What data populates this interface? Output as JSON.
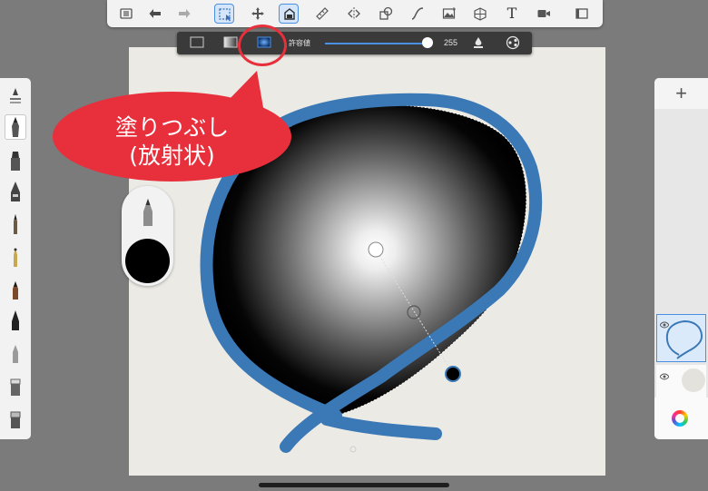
{
  "toolbar": {
    "tools": [
      {
        "name": "list-icon"
      },
      {
        "name": "undo-icon"
      },
      {
        "name": "redo-icon"
      },
      {
        "name": "selection-tool-icon",
        "active": true
      },
      {
        "name": "transform-icon"
      },
      {
        "name": "fill-tool-icon",
        "active": true
      },
      {
        "name": "ruler-icon"
      },
      {
        "name": "symmetry-icon"
      },
      {
        "name": "shapes-icon"
      },
      {
        "name": "curve-icon"
      },
      {
        "name": "image-import-icon"
      },
      {
        "name": "perspective-icon"
      },
      {
        "name": "text-tool-icon",
        "label": "T"
      },
      {
        "name": "video-icon"
      },
      {
        "name": "window-icon"
      }
    ]
  },
  "fill_bar": {
    "modes": [
      "solid-fill-icon",
      "linear-gradient-icon",
      "radial-gradient-icon"
    ],
    "active_mode": "radial-gradient-icon",
    "tolerance_label": "許容値",
    "tolerance_value": "255",
    "tolerance_fraction": 1.0
  },
  "callout": {
    "line1": "塗りつぶし",
    "line2": "(放射状)"
  },
  "colors": {
    "accent": "#4b8fe0",
    "annotation_red": "#e8303c",
    "stroke_blue": "#3a78b6",
    "canvas_bg": "#eceae4",
    "current_color": "#000000"
  },
  "layers_panel": {
    "add_label": "+",
    "layers": [
      {
        "name": "layer-1",
        "visible": true,
        "active": true
      },
      {
        "name": "background-layer",
        "visible": true,
        "active": false
      }
    ],
    "color_wheel": "color-wheel-icon"
  }
}
